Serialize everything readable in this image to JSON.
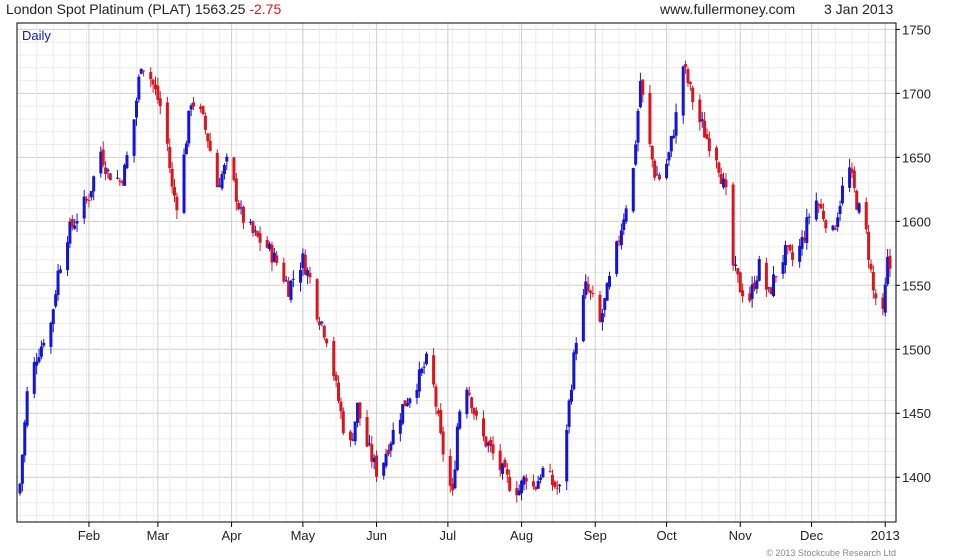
{
  "header": {
    "instrument": "London Spot Platinum (PLAT)",
    "last": "1563.25",
    "change": "-2.75",
    "site": "www.fullermoney.com",
    "date": "3 Jan 2013"
  },
  "footer": "© 2013 Stockcube Research Ltd",
  "colors": {
    "up": "#1414d2",
    "down": "#d8161f",
    "grid": "#dcdcdc",
    "frame": "#000000"
  },
  "chart_data": {
    "type": "candlestick",
    "period_label": "Daily",
    "x_tick_labels": [
      "Feb",
      "Mar",
      "Apr",
      "May",
      "Jun",
      "Jul",
      "Aug",
      "Sep",
      "Oct",
      "Nov",
      "Dec",
      "2013"
    ],
    "y_ticks": [
      1400,
      1450,
      1500,
      1550,
      1600,
      1650,
      1700,
      1750
    ],
    "ylim": [
      1365,
      1755
    ],
    "y_axis_side": "right",
    "grid": true,
    "anchors": [
      [
        "Jan 3",
        1395
      ],
      [
        "Jan 6",
        1465
      ],
      [
        "Jan 10",
        1495
      ],
      [
        "Jan 16",
        1520
      ],
      [
        "Jan 19",
        1560
      ],
      [
        "Jan 23",
        1590
      ],
      [
        "Jan 26",
        1600
      ],
      [
        "Feb 1",
        1620
      ],
      [
        "Feb 6",
        1655
      ],
      [
        "Feb 9",
        1638
      ],
      [
        "Feb 14",
        1632
      ],
      [
        "Feb 16",
        1640
      ],
      [
        "Feb 20",
        1680
      ],
      [
        "Feb 23",
        1725
      ],
      [
        "Feb 27",
        1712
      ],
      [
        "Mar 2",
        1690
      ],
      [
        "Mar 5",
        1660
      ],
      [
        "Mar 7",
        1625
      ],
      [
        "Mar 10",
        1610
      ],
      [
        "Mar 12",
        1650
      ],
      [
        "Mar 15",
        1695
      ],
      [
        "Mar 19",
        1685
      ],
      [
        "Mar 22",
        1665
      ],
      [
        "Mar 26",
        1628
      ],
      [
        "Mar 30",
        1645
      ],
      [
        "Apr 2",
        1628
      ],
      [
        "Apr 5",
        1605
      ],
      [
        "Apr 10",
        1590
      ],
      [
        "Apr 16",
        1580
      ],
      [
        "Apr 21",
        1565
      ],
      [
        "Apr 25",
        1548
      ],
      [
        "Apr 28",
        1560
      ],
      [
        "May 1",
        1570
      ],
      [
        "May 4",
        1555
      ],
      [
        "May 7",
        1530
      ],
      [
        "May 12",
        1505
      ],
      [
        "May 15",
        1470
      ],
      [
        "May 18",
        1440
      ],
      [
        "May 21",
        1425
      ],
      [
        "May 24",
        1455
      ],
      [
        "May 27",
        1430
      ],
      [
        "May 30",
        1415
      ],
      [
        "Jun 2",
        1400
      ],
      [
        "Jun 5",
        1420
      ],
      [
        "Jun 9",
        1440
      ],
      [
        "Jun 12",
        1455
      ],
      [
        "Jun 15",
        1465
      ],
      [
        "Jun 19",
        1478
      ],
      [
        "Jun 22",
        1490
      ],
      [
        "Jun 25",
        1470
      ],
      [
        "Jun 28",
        1430
      ],
      [
        "Jul 1",
        1400
      ],
      [
        "Jul 3",
        1385
      ],
      [
        "Jul 5",
        1440
      ],
      [
        "Jul 8",
        1480
      ],
      [
        "Jul 11",
        1460
      ],
      [
        "Jul 14",
        1435
      ],
      [
        "Jul 18",
        1425
      ],
      [
        "Jul 22",
        1410
      ],
      [
        "Jul 27",
        1395
      ],
      [
        "Jul 31",
        1390
      ],
      [
        "Aug 3",
        1402
      ],
      [
        "Aug 6",
        1392
      ],
      [
        "Aug 10",
        1405
      ],
      [
        "Aug 14",
        1395
      ],
      [
        "Aug 17",
        1390
      ],
      [
        "Aug 20",
        1440
      ],
      [
        "Aug 24",
        1510
      ],
      [
        "Aug 28",
        1548
      ],
      [
        "Aug 31",
        1538
      ],
      [
        "Sep 3",
        1520
      ],
      [
        "Sep 6",
        1545
      ],
      [
        "Sep 10",
        1578
      ],
      [
        "Sep 13",
        1605
      ],
      [
        "Sep 17",
        1640
      ],
      [
        "Sep 20",
        1710
      ],
      [
        "Sep 23",
        1668
      ],
      [
        "Sep 26",
        1638
      ],
      [
        "Sep 29",
        1632
      ],
      [
        "Oct 2",
        1652
      ],
      [
        "Oct 5",
        1682
      ],
      [
        "Oct 8",
        1722
      ],
      [
        "Oct 11",
        1702
      ],
      [
        "Oct 14",
        1682
      ],
      [
        "Oct 18",
        1665
      ],
      [
        "Oct 22",
        1652
      ],
      [
        "Oct 26",
        1620
      ],
      [
        "Oct 29",
        1565
      ],
      [
        "Nov 1",
        1548
      ],
      [
        "Nov 5",
        1540
      ],
      [
        "Nov 9",
        1565
      ],
      [
        "Nov 13",
        1542
      ],
      [
        "Nov 16",
        1560
      ],
      [
        "Nov 20",
        1575
      ],
      [
        "Nov 24",
        1568
      ],
      [
        "Nov 28",
        1590
      ],
      [
        "Dec 2",
        1620
      ],
      [
        "Dec 6",
        1605
      ],
      [
        "Dec 10",
        1590
      ],
      [
        "Dec 14",
        1625
      ],
      [
        "Dec 17",
        1640
      ],
      [
        "Dec 20",
        1615
      ],
      [
        "Dec 24",
        1590
      ],
      [
        "Dec 27",
        1545
      ],
      [
        "Dec 31",
        1525
      ],
      [
        "Jan 2",
        1568
      ],
      [
        "Jan 3",
        1563
      ]
    ]
  }
}
